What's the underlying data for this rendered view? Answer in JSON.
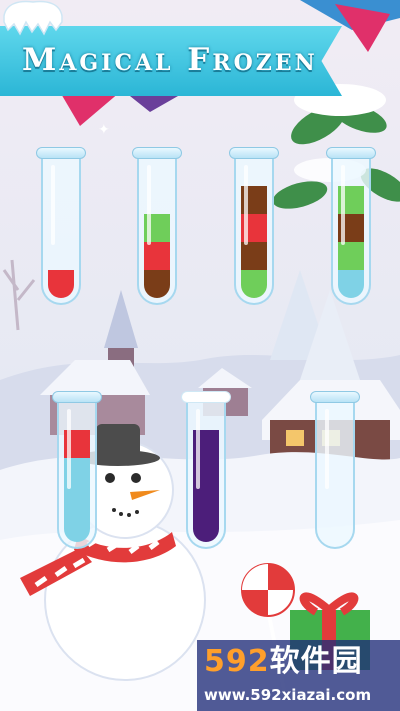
{
  "game": {
    "title": "Magical Frozen"
  },
  "colors": {
    "red": "#e8343b",
    "green": "#6fce5a",
    "brown": "#7a3d18",
    "blue": "#7fd2e6",
    "purple": "#4c1e7a",
    "banner": "#3cc3e0"
  },
  "tubes": [
    {
      "layers": [
        "red"
      ]
    },
    {
      "layers": [
        "brown",
        "red",
        "green"
      ]
    },
    {
      "layers": [
        "green",
        "brown",
        "red",
        "brown"
      ]
    },
    {
      "layers": [
        "blue",
        "green",
        "brown",
        "green"
      ]
    },
    {
      "layers": [
        "blue",
        "blue",
        "blue",
        "red"
      ]
    },
    {
      "layers": [
        "purple",
        "purple",
        "purple",
        "purple"
      ],
      "frozen": true
    },
    {
      "layers": []
    }
  ],
  "watermark": {
    "brand_num": "592",
    "brand_cn": "软件园",
    "url": "www.592xiazai.com"
  }
}
